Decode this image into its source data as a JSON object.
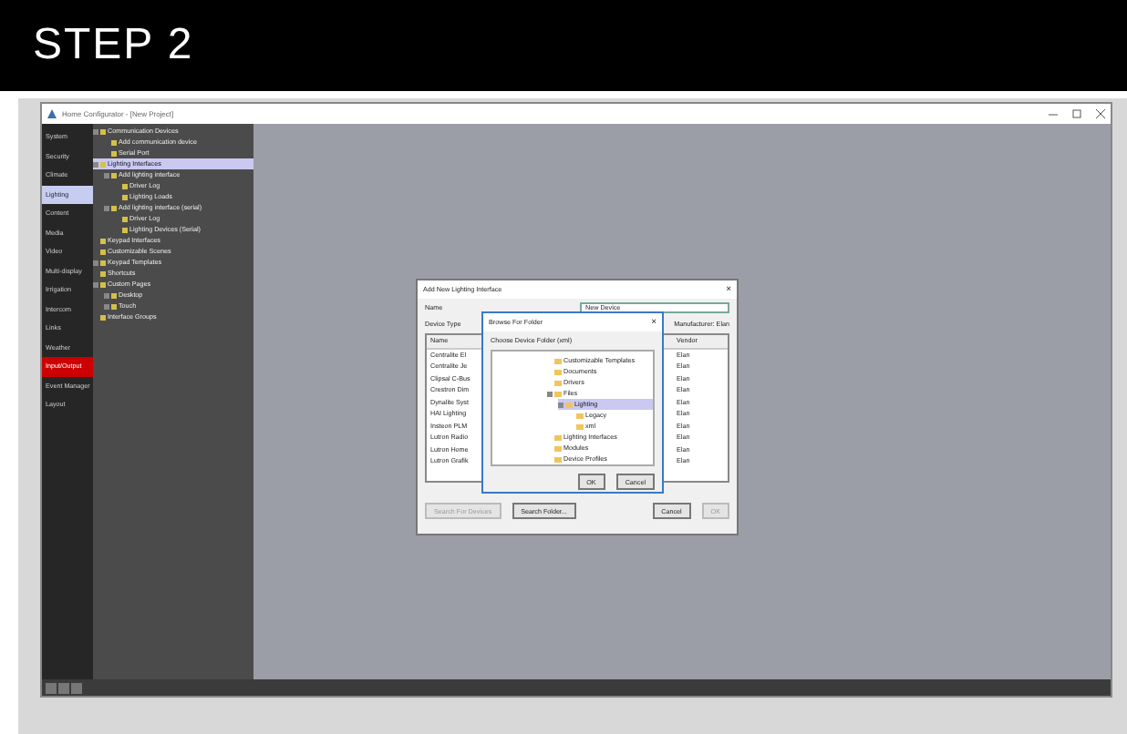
{
  "header": {
    "title": "STEP 2"
  },
  "window": {
    "title": "Home Configurator - [New Project]"
  },
  "sidebar": {
    "items": [
      {
        "label": "System",
        "selected": false,
        "alert": false
      },
      {
        "label": "Security",
        "selected": false,
        "alert": false
      },
      {
        "label": "Climate",
        "selected": false,
        "alert": false
      },
      {
        "label": "Lighting",
        "selected": true,
        "alert": false
      },
      {
        "label": "Content",
        "selected": false,
        "alert": false
      },
      {
        "label": "Media",
        "selected": false,
        "alert": false
      },
      {
        "label": "Video",
        "selected": false,
        "alert": false
      },
      {
        "label": "Multi-display",
        "selected": false,
        "alert": false
      },
      {
        "label": "Irrigation",
        "selected": false,
        "alert": false
      },
      {
        "label": "Intercom",
        "selected": false,
        "alert": false
      },
      {
        "label": "Links",
        "selected": false,
        "alert": false
      },
      {
        "label": "Weather",
        "selected": false,
        "alert": false
      },
      {
        "label": "Input/Output",
        "selected": false,
        "alert": true
      },
      {
        "label": "Event Manager",
        "selected": false,
        "alert": false
      },
      {
        "label": "Layout",
        "selected": false,
        "alert": false
      }
    ]
  },
  "tree": {
    "items": [
      {
        "label": "Communication Devices",
        "expanded": true,
        "selected": false,
        "children": [
          {
            "label": "Add communication device",
            "expanded": false,
            "selected": false
          },
          {
            "label": "Serial Port",
            "expanded": false,
            "selected": false
          }
        ]
      },
      {
        "label": "Lighting Interfaces",
        "expanded": true,
        "selected": true,
        "children": [
          {
            "label": "Add lighting interface",
            "expanded": true,
            "selected": false,
            "children": [
              {
                "label": "Driver Log",
                "expanded": false,
                "selected": false
              },
              {
                "label": "Lighting Loads",
                "expanded": false,
                "selected": false
              }
            ]
          },
          {
            "label": "Add lighting interface (serial)",
            "expanded": true,
            "selected": false,
            "children": [
              {
                "label": "Driver Log",
                "expanded": false,
                "selected": false
              },
              {
                "label": "Lighting Devices (Serial)",
                "expanded": false,
                "selected": false
              }
            ]
          }
        ]
      },
      {
        "label": "Keypad Interfaces",
        "expanded": false,
        "selected": false
      },
      {
        "label": "Customizable Scenes",
        "expanded": false,
        "selected": false
      },
      {
        "label": "Keypad Templates",
        "expanded": true,
        "selected": false
      },
      {
        "label": "Shortcuts",
        "expanded": false,
        "selected": false
      },
      {
        "label": "Custom Pages",
        "expanded": true,
        "selected": false,
        "children": [
          {
            "label": "Desktop",
            "expanded": true,
            "selected": false
          },
          {
            "label": "Touch",
            "expanded": true,
            "selected": false
          }
        ]
      },
      {
        "label": "Interface Groups",
        "expanded": false,
        "selected": false
      }
    ]
  },
  "add_dialog": {
    "title": "Add New Lighting Interface",
    "name_label": "Name",
    "name_value": "New Device",
    "type_label": "Device Type",
    "filter_label": "Manufacturer: Elan",
    "columns": [
      "Name",
      "Vendor"
    ],
    "rows": [
      {
        "name": "Centralite El",
        "vendor": "Elan"
      },
      {
        "name": "Centralite Je",
        "vendor": "Elan"
      },
      {
        "name": "Clipsal C-Bus",
        "vendor": "Elan"
      },
      {
        "name": "Crestron Dim",
        "vendor": "Elan"
      },
      {
        "name": "Dynalite Syst",
        "vendor": "Elan"
      },
      {
        "name": "HAI Lighting",
        "vendor": "Elan"
      },
      {
        "name": "Insteon PLM",
        "vendor": "Elan"
      },
      {
        "name": "Lutron Radio",
        "vendor": "Elan"
      },
      {
        "name": "Lutron Home",
        "vendor": "Elan"
      },
      {
        "name": "Lutron Grafik",
        "vendor": "Elan"
      }
    ],
    "close": "×",
    "buttons": [
      {
        "label": "Search For Devices",
        "disabled": true
      },
      {
        "label": "Search Folder...",
        "disabled": false
      },
      {
        "label": "Cancel",
        "disabled": false
      },
      {
        "label": "OK",
        "disabled": true
      }
    ]
  },
  "browse_dialog": {
    "title": "Browse For Folder",
    "prompt": "Choose Device Folder (xml)",
    "close": "×",
    "tree": [
      {
        "label": "Customizable Templates",
        "expanded": false,
        "selected": false
      },
      {
        "label": "Documents",
        "expanded": false,
        "selected": false
      },
      {
        "label": "Drivers",
        "expanded": false,
        "selected": false
      },
      {
        "label": "Files",
        "expanded": true,
        "selected": false,
        "children": [
          {
            "label": "Lighting",
            "expanded": true,
            "selected": true,
            "children": [
              {
                "label": "Legacy",
                "expanded": false,
                "selected": false
              },
              {
                "label": "xml",
                "expanded": false,
                "selected": false
              }
            ]
          }
        ]
      },
      {
        "label": "Lighting Interfaces",
        "expanded": false,
        "selected": false
      },
      {
        "label": "Modules",
        "expanded": false,
        "selected": false
      },
      {
        "label": "Device Profiles",
        "expanded": false,
        "selected": false
      }
    ],
    "buttons": [
      {
        "label": "OK"
      },
      {
        "label": "Cancel"
      }
    ]
  }
}
